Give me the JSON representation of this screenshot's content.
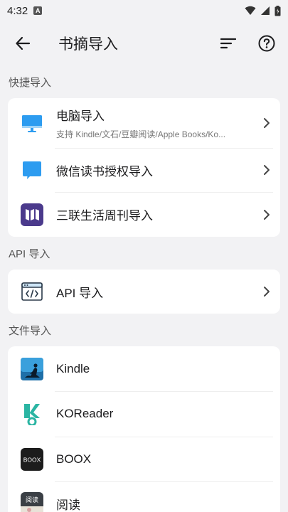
{
  "status_bar": {
    "time": "4:32",
    "badge": "A"
  },
  "app_bar": {
    "title": "书摘导入"
  },
  "sections": {
    "quick": {
      "header": "快捷导入",
      "items": [
        {
          "title": "电脑导入",
          "subtitle": "支持 Kindle/文石/豆瓣阅读/Apple Books/Ko...",
          "icon": "monitor-icon"
        },
        {
          "title": "微信读书授权导入",
          "icon": "wechat-read-icon"
        },
        {
          "title": "三联生活周刊导入",
          "icon": "sanlian-icon"
        }
      ]
    },
    "api": {
      "header": "API 导入",
      "items": [
        {
          "title": "API 导入",
          "icon": "code-window-icon"
        }
      ]
    },
    "file": {
      "header": "文件导入",
      "items": [
        {
          "title": "Kindle",
          "icon": "kindle-icon"
        },
        {
          "title": "KOReader",
          "icon": "koreader-icon"
        },
        {
          "title": "BOOX",
          "icon": "boox-icon",
          "logo_text": "BOOX"
        },
        {
          "title": "阅读",
          "icon": "yuedu-icon",
          "logo_text": "阅读"
        }
      ]
    }
  },
  "colors": {
    "accent_blue": "#2d9cf0",
    "sanlian_purple": "#4b3a8c",
    "background": "#f2f2f4"
  }
}
